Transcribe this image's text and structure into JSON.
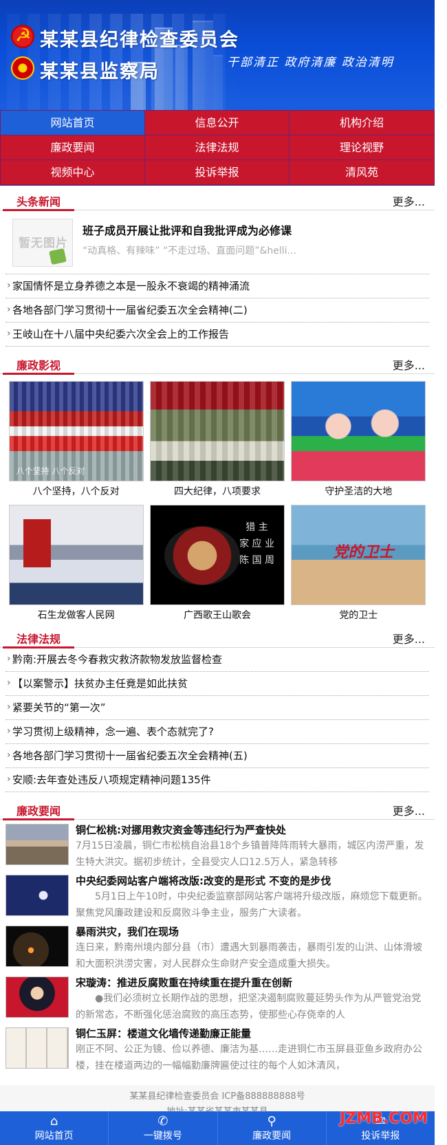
{
  "header": {
    "title_line1": "某某县纪律检查委员会",
    "title_line2": "某某县监察局",
    "slogan": "干部清正  政府清廉  政治清明"
  },
  "nav": [
    {
      "label": "网站首页",
      "active": true
    },
    {
      "label": "信息公开"
    },
    {
      "label": "机构介绍"
    },
    {
      "label": "廉政要闻"
    },
    {
      "label": "法律法规"
    },
    {
      "label": "理论视野"
    },
    {
      "label": "视频中心"
    },
    {
      "label": "投诉举报"
    },
    {
      "label": "清风苑"
    }
  ],
  "more_label": "更多...",
  "headlines": {
    "title": "头条新闻",
    "feature": {
      "noimg_text": "暂无图片",
      "title": "班子成员开展让批评和自我批评成为必修课",
      "desc": "“动真格、有辣味” “不走过场、直面问题”&helli..."
    },
    "items": [
      "家国情怀是立身养德之本是一股永不衰竭的精神涌流",
      "各地各部门学习贯彻十一届省纪委五次全会精神(二)",
      "王岐山在十八届中央纪委六次全会上的工作报告"
    ]
  },
  "videos": {
    "title": "廉政影视",
    "items": [
      {
        "caption": "八个坚持，八个反对",
        "overlay": "八个坚持 八个反对"
      },
      {
        "caption": "四大纪律，八项要求",
        "overlay": ""
      },
      {
        "caption": "守护圣洁的大地",
        "overlay": ""
      },
      {
        "caption": "石生龙做客人民网",
        "overlay": ""
      },
      {
        "caption": "广西歌王山歌会",
        "overlay": ""
      },
      {
        "caption": "党的卫士",
        "overlay": ""
      }
    ]
  },
  "laws": {
    "title": "法律法规",
    "items": [
      "黔南:开展去冬今春救灾救济款物发放监督检查",
      "【以案警示】扶贫办主任竟是如此扶贫",
      "紧要关节的“第一次”",
      "学习贯彻上级精神，念一遍、表个态就完了?",
      "各地各部门学习贯彻十一届省纪委五次全会精神(五)",
      "安顺:去年查处违反八项规定精神问题135件"
    ]
  },
  "politics": {
    "title": "廉政要闻",
    "items": [
      {
        "title": "铜仁松桃:对挪用救灾资金等违纪行为严查快处",
        "desc": "7月15日凌晨，铜仁市松桃自治县18个乡镇普降阵雨转大暴雨，城区内涝严重，发生特大洪灾。据初步统计，全县受灾人口12.5万人，紧急转移"
      },
      {
        "title": "中央纪委网站客户端将改版:改变的是形式 不变的是步伐",
        "desc": "　　5月1日上午10时，中央纪委监察部网站客户端将升级改版，麻烦您下载更新。　　聚焦党风廉政建设和反腐败斗争主业，服务广大读者。"
      },
      {
        "title": "暴雨洪灾，我们在现场",
        "desc": "连日来，黔南州境内部分县（市）遭遇大到暴雨袭击，暴雨引发的山洪、山体滑坡和大面积洪涝灾害，对人民群众生命财产安全造成重大损失。"
      },
      {
        "title": "宋璇涛：推进反腐败重在持续重在提升重在创新",
        "desc": "　　●我们必须树立长期作战的思想，把坚决遏制腐败蔓延势头作为从严管党治党的新常态，不断强化惩治腐败的高压态势，使那些心存侥幸的人"
      },
      {
        "title": "铜仁玉屏：楼道文化墙传递勤廉正能量",
        "desc": "刚正不阿、公正为镜、俭以养德、廉洁为基……走进铜仁市玉屏县亚鱼乡政府办公楼，挂在楼道两边的一幅幅勤廉牌匾使过往的每个人如沐清风，"
      }
    ]
  },
  "footer": {
    "line1": "某某县纪律检查委员会  ICP备888888888号",
    "line2": "地址:某某省某某市某某县"
  },
  "bottom_bar": [
    {
      "label": "网站首页",
      "icon": "home-icon"
    },
    {
      "label": "一键拨号",
      "icon": "phone-icon"
    },
    {
      "label": "廉政要闻",
      "icon": "location-icon"
    },
    {
      "label": "投诉举报",
      "icon": "message-icon"
    }
  ],
  "watermark": "JZMB.COM",
  "colors": {
    "brand_blue": "#1e60d8",
    "brand_red": "#c8162d"
  }
}
